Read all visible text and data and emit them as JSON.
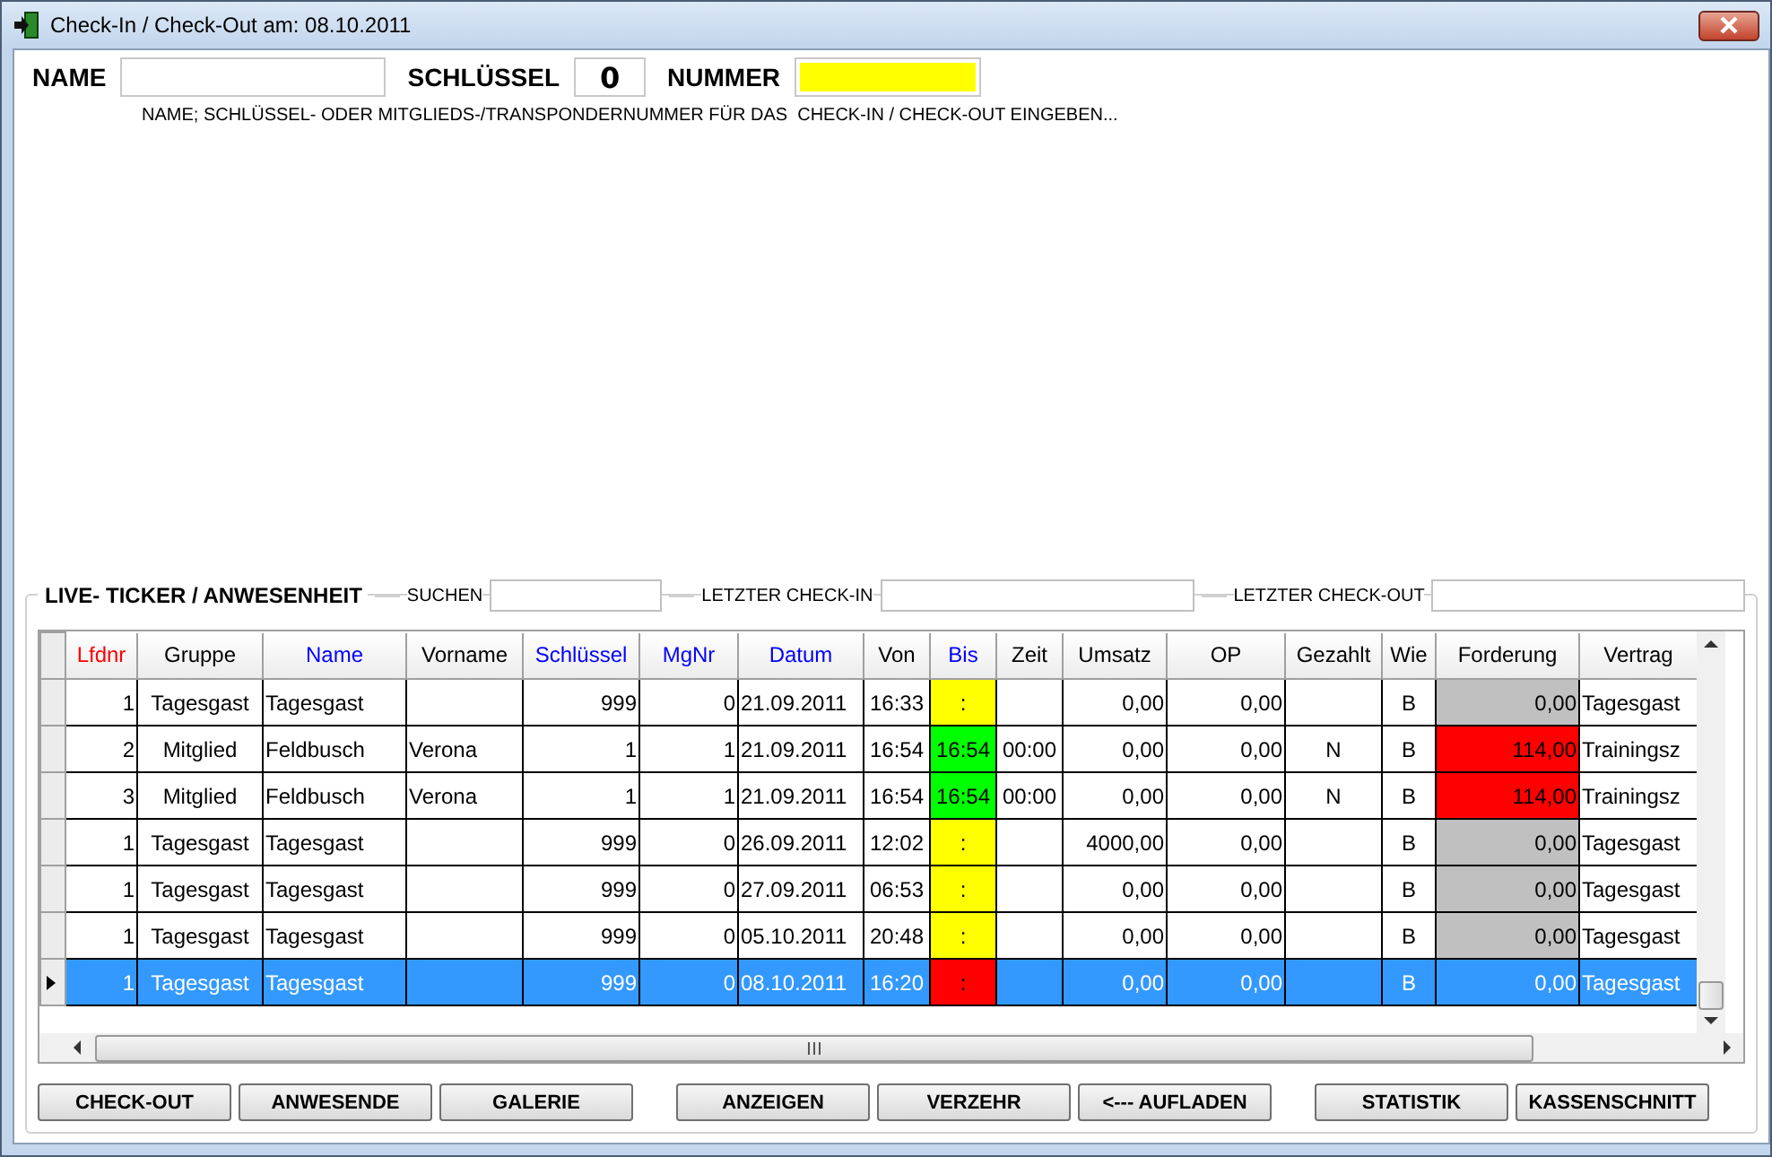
{
  "window": {
    "title": "Check-In / Check-Out am: 08.10.2011"
  },
  "entry": {
    "name_label": "NAME",
    "key_label": "SCHLÜSSEL",
    "key_value": "0",
    "number_label": "NUMMER",
    "hint": "NAME; SCHLÜSSEL- ODER MITGLIEDS-/TRANSPONDERNUMMER FÜR DAS  CHECK-IN / CHECK-OUT EINGEBEN..."
  },
  "ticker": {
    "title": "LIVE- TICKER / ANWESENHEIT",
    "search_label": "SUCHEN",
    "last_checkin_label": "LETZTER CHECK-IN",
    "last_checkout_label": "LETZTER CHECK-OUT"
  },
  "table": {
    "columns": [
      {
        "label": "Lfdnr",
        "color": "#ff0000"
      },
      {
        "label": "Gruppe",
        "color": "#000000"
      },
      {
        "label": "Name",
        "color": "#0000ff"
      },
      {
        "label": "Vorname",
        "color": "#000000"
      },
      {
        "label": "Schlüssel",
        "color": "#0000ff"
      },
      {
        "label": "MgNr",
        "color": "#0000ff"
      },
      {
        "label": "Datum",
        "color": "#0000ff"
      },
      {
        "label": "Von",
        "color": "#000000"
      },
      {
        "label": "Bis",
        "color": "#0000ff"
      },
      {
        "label": "Zeit",
        "color": "#000000"
      },
      {
        "label": "Umsatz",
        "color": "#000000"
      },
      {
        "label": "OP",
        "color": "#000000"
      },
      {
        "label": "Gezahlt",
        "color": "#000000"
      },
      {
        "label": "Wie",
        "color": "#000000"
      },
      {
        "label": "Forderung",
        "color": "#000000"
      },
      {
        "label": "Vertrag",
        "color": "#000000"
      }
    ],
    "rows": [
      {
        "selected": false,
        "cells": [
          "1",
          "Tagesgast",
          "Tagesgast",
          null,
          "999",
          "0",
          "21.09.2011",
          "16:33",
          {
            "text": ":",
            "color": "#ffff00"
          },
          null,
          "0,00",
          "0,00",
          null,
          "B",
          {
            "text": "0,00",
            "color": "#c0c0c0"
          },
          "Tagesgast"
        ]
      },
      {
        "selected": false,
        "cells": [
          "2",
          "Mitglied",
          "Feldbusch",
          "Verona",
          "1",
          "1",
          "21.09.2011",
          "16:54",
          {
            "text": "16:54",
            "color": "#00ff00"
          },
          "00:00",
          "0,00",
          "0,00",
          "N",
          "B",
          {
            "text": "114,00",
            "color": "#ff0000"
          },
          "Trainingsz"
        ]
      },
      {
        "selected": false,
        "cells": [
          "3",
          "Mitglied",
          "Feldbusch",
          "Verona",
          "1",
          "1",
          "21.09.2011",
          "16:54",
          {
            "text": "16:54",
            "color": "#00ff00"
          },
          "00:00",
          "0,00",
          "0,00",
          "N",
          "B",
          {
            "text": "114,00",
            "color": "#ff0000"
          },
          "Trainingsz"
        ]
      },
      {
        "selected": false,
        "cells": [
          "1",
          "Tagesgast",
          "Tagesgast",
          null,
          "999",
          "0",
          "26.09.2011",
          "12:02",
          {
            "text": ":",
            "color": "#ffff00"
          },
          null,
          "4000,00",
          "0,00",
          null,
          "B",
          {
            "text": "0,00",
            "color": "#c0c0c0"
          },
          "Tagesgast"
        ]
      },
      {
        "selected": false,
        "cells": [
          "1",
          "Tagesgast",
          "Tagesgast",
          null,
          "999",
          "0",
          "27.09.2011",
          "06:53",
          {
            "text": ":",
            "color": "#ffff00"
          },
          null,
          "0,00",
          "0,00",
          null,
          "B",
          {
            "text": "0,00",
            "color": "#c0c0c0"
          },
          "Tagesgast"
        ]
      },
      {
        "selected": false,
        "cells": [
          "1",
          "Tagesgast",
          "Tagesgast",
          null,
          "999",
          "0",
          "05.10.2011",
          "20:48",
          {
            "text": ":",
            "color": "#ffff00"
          },
          null,
          "0,00",
          "0,00",
          null,
          "B",
          {
            "text": "0,00",
            "color": "#c0c0c0"
          },
          "Tagesgast"
        ]
      },
      {
        "selected": true,
        "cells": [
          "1",
          "Tagesgast",
          "Tagesgast",
          null,
          "999",
          "0",
          "08.10.2011",
          "16:20",
          {
            "text": ":",
            "color": "#ff0000"
          },
          null,
          "0,00",
          "0,00",
          null,
          "B",
          "0,00",
          "Tagesgast"
        ]
      }
    ]
  },
  "buttons": [
    {
      "label": "CHECK-OUT"
    },
    {
      "label": "ANWESENDE"
    },
    {
      "label": "GALERIE"
    },
    {
      "label": "ANZEIGEN"
    },
    {
      "label": "VERZEHR"
    },
    {
      "label": "<--- AUFLADEN"
    },
    {
      "label": "STATISTIK"
    },
    {
      "label": "KASSENSCHNITT"
    }
  ]
}
